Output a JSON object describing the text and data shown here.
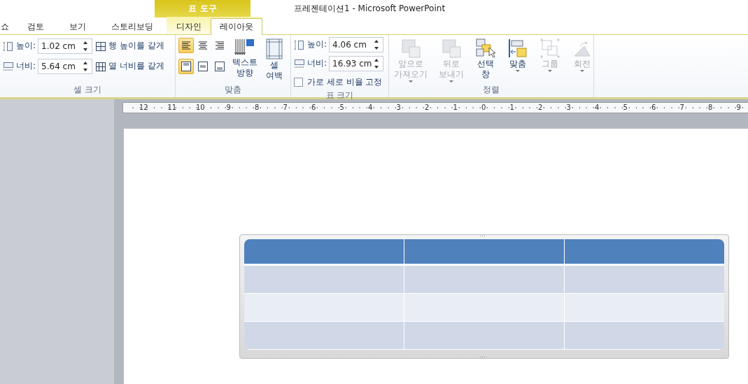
{
  "window": {
    "title": "프레젠테이션1  -  Microsoft PowerPoint"
  },
  "context_tab": {
    "label": "표 도구"
  },
  "tabs": [
    {
      "label": "쇼",
      "selected": false
    },
    {
      "label": "검토",
      "selected": false
    },
    {
      "label": "보기",
      "selected": false
    },
    {
      "label": "스토리보딩",
      "selected": false
    },
    {
      "label": "디자인",
      "selected": false
    },
    {
      "label": "레이아웃",
      "selected": true
    }
  ],
  "groups": [
    {
      "kind": "cell_size",
      "label": "셀 크기",
      "height": {
        "label": "높이:",
        "value": "1.02 cm"
      },
      "width": {
        "label": "너비:",
        "value": "5.64 cm"
      },
      "buttons": [
        "행 높이를 같게",
        "열 너비를 같게"
      ]
    },
    {
      "kind": "alignment",
      "label": "맞춤",
      "align_buttons": [
        {
          "selected": true
        },
        {
          "selected": false
        },
        {
          "selected": false
        },
        {
          "selected": true
        },
        {
          "selected": false
        },
        {
          "selected": false
        }
      ],
      "text_direction": {
        "label": "텍스트\n방향"
      },
      "cell_margin": {
        "label": "셀\n여백"
      }
    },
    {
      "kind": "table_size",
      "label": "표 크기",
      "height": {
        "label": "높이:",
        "value": "4.06 cm"
      },
      "width": {
        "label": "너비:",
        "value": "16.93 cm"
      },
      "lock_ratio": {
        "label": "가로 세로 비율 고정",
        "checked": false
      }
    },
    {
      "kind": "arrange",
      "label": "정렬",
      "buttons": [
        {
          "label": "앞으로\n가져오기",
          "disabled": true,
          "dropdown": true
        },
        {
          "label": "뒤로\n보내기",
          "disabled": true,
          "dropdown": true
        },
        {
          "label": "선택\n창",
          "disabled": false,
          "dropdown": false
        },
        {
          "label": "맞춤",
          "disabled": false,
          "dropdown": true
        },
        {
          "label": "그룹",
          "disabled": true,
          "dropdown": true
        },
        {
          "label": "회전",
          "disabled": true,
          "dropdown": true
        }
      ]
    }
  ],
  "ruler": [
    "12",
    "11",
    "10",
    "9",
    "8",
    "7",
    "6",
    "5",
    "4",
    "3",
    "2",
    "1",
    "0",
    "1",
    "2",
    "3",
    "4",
    "5",
    "6",
    "7",
    "8",
    "9"
  ],
  "table": {
    "rows": [
      {
        "kind": "header",
        "cells": [
          {
            "kind": "empty"
          },
          {
            "kind": "empty"
          },
          {
            "kind": "empty"
          }
        ]
      },
      {
        "kind": "band",
        "cells": [
          {
            "kind": "empty"
          },
          {
            "kind": "empty"
          },
          {
            "kind": "empty"
          }
        ]
      },
      {
        "kind": "plain",
        "cells": [
          {
            "kind": "empty"
          },
          {
            "kind": "empty"
          },
          {
            "kind": "empty"
          }
        ]
      },
      {
        "kind": "band",
        "cells": [
          {
            "kind": "empty"
          },
          {
            "kind": "empty"
          },
          {
            "kind": "empty"
          }
        ]
      }
    ]
  }
}
